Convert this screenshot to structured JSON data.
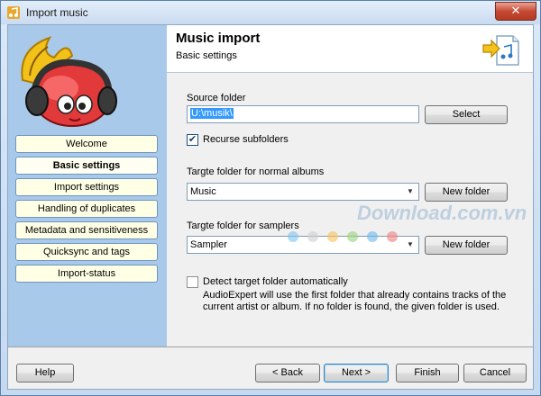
{
  "window": {
    "title": "Import music",
    "close_label": "✕"
  },
  "sidebar": {
    "items": [
      {
        "label": "Welcome",
        "active": false
      },
      {
        "label": "Basic settings",
        "active": true
      },
      {
        "label": "Import settings",
        "active": false
      },
      {
        "label": "Handling of duplicates",
        "active": false
      },
      {
        "label": "Metadata and sensitiveness",
        "active": false
      },
      {
        "label": "Quicksync and tags",
        "active": false
      },
      {
        "label": "Import-status",
        "active": false
      }
    ]
  },
  "header": {
    "title": "Music import",
    "subtitle": "Basic settings"
  },
  "form": {
    "source_label": "Source folder",
    "source_value": "U:\\musik\\",
    "select_label": "Select",
    "recurse_label": "Recurse subfolders",
    "recurse_checked": true,
    "target_normal_label": "Targte folder for normal albums",
    "target_normal_value": "Music",
    "new_folder_label": "New folder",
    "target_samplers_label": "Targte folder for samplers",
    "target_samplers_value": "Sampler",
    "new_folder_label_2": "New folder",
    "detect_label": "Detect target folder automatically",
    "detect_checked": false,
    "detect_desc_1": "AudioExpert will use the first folder that already contains tracks of the",
    "detect_desc_2": "current artist or album. If no folder is found, the given folder is used."
  },
  "footer": {
    "help": "Help",
    "back": "< Back",
    "next": "Next >",
    "finish": "Finish",
    "cancel": "Cancel"
  },
  "watermark": {
    "text": "Download.com.vn"
  }
}
